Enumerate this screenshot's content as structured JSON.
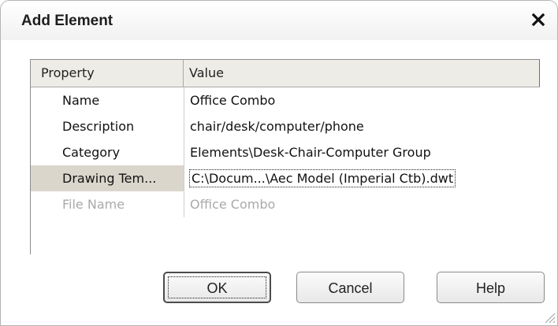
{
  "dialog": {
    "title": "Add Element",
    "close_icon": "close-icon"
  },
  "grid": {
    "headers": {
      "property": "Property",
      "value": "Value"
    },
    "rows": [
      {
        "property": "Name",
        "value": "Office Combo",
        "state": "normal"
      },
      {
        "property": "Description",
        "value": "chair/desk/computer/phone",
        "state": "normal"
      },
      {
        "property": "Category",
        "value": "Elements\\Desk-Chair-Computer Group",
        "state": "normal"
      },
      {
        "property": "Drawing Tem...",
        "value": "C:\\Docum...\\Aec Model (Imperial Ctb).dwt",
        "state": "selected"
      },
      {
        "property": "File Name",
        "value": "Office Combo",
        "state": "disabled"
      }
    ]
  },
  "buttons": {
    "ok": "OK",
    "cancel": "Cancel",
    "help": "Help"
  },
  "colors": {
    "header_bg": "#eeece6",
    "selected_bg": "#dad6cc",
    "disabled_text": "#aaaaaa"
  }
}
